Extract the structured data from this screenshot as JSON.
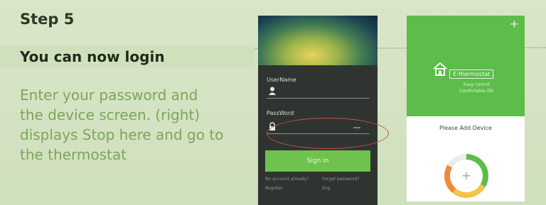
{
  "step": {
    "title": "Step 5",
    "subtitle": "You can now login"
  },
  "instructions": [
    "Enter your password  and",
    "the  device  screen. (right)",
    "displays Stop here  and go to",
    "the thermostat"
  ],
  "login_screen": {
    "username_label": "UserName",
    "password_label": "PassWord",
    "sign_in_label": "Sign in",
    "link_row1_left": "No account already?",
    "link_row1_right": "Forget password?",
    "link_row2_left": "Register",
    "link_row2_right": "Eng"
  },
  "app_screen": {
    "brand": "E-thermostat",
    "tagline_1": "Easy control",
    "tagline_2": "Comfortable life",
    "please_add": "Please Add Device",
    "plus_icon": "+",
    "gauge_plus": "+"
  },
  "colors": {
    "accent": "#5cbd4a",
    "text_green": "#7da55a",
    "highlight_ring": "#c9504e"
  }
}
